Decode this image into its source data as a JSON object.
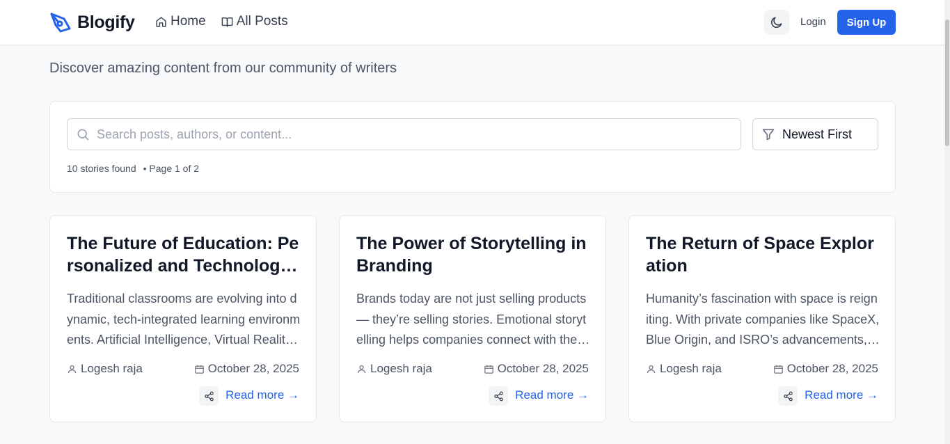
{
  "header": {
    "logo_text": "Blogify",
    "nav": [
      {
        "label": "Home",
        "icon": "home-icon"
      },
      {
        "label": "All Posts",
        "icon": "book-open-icon"
      }
    ],
    "theme_icon": "moon-icon",
    "login_label": "Login",
    "signup_label": "Sign Up"
  },
  "tagline": "Discover amazing content from our community of writers",
  "search": {
    "placeholder": "Search posts, authors, or content...",
    "value": "",
    "sort_label": "Newest First",
    "results_count": "10 stories found",
    "page_info": "• Page 1 of 2"
  },
  "posts": [
    {
      "title": "The Future of Education: Personalized and Technology-Driven Learning",
      "excerpt": "Traditional classrooms are evolving into dynamic, tech-integrated learning environments. Artificial Intelligence, Virtual Reality, and online platforms are transforming education.",
      "author": "Logesh raja",
      "date": "October 28, 2025",
      "read_more": "Read more →"
    },
    {
      "title": "The Power of Storytelling in Branding",
      "excerpt": "Brands today are not just selling products — they’re selling stories. Emotional storytelling helps companies connect with their audiences on a deeper level.",
      "author": "Logesh raja",
      "date": "October 28, 2025",
      "read_more": "Read more →"
    },
    {
      "title": "The Return of Space Exploration",
      "excerpt": "Humanity’s fascination with space is reigniting. With private companies like SpaceX, Blue Origin, and ISRO’s advancements, a new era of exploration begins.",
      "author": "Logesh raja",
      "date": "October 28, 2025",
      "read_more": "Read more →"
    }
  ],
  "colors": {
    "accent": "#2563eb",
    "background": "#f8f9fb",
    "card": "#ffffff",
    "border": "#e5e7eb"
  }
}
